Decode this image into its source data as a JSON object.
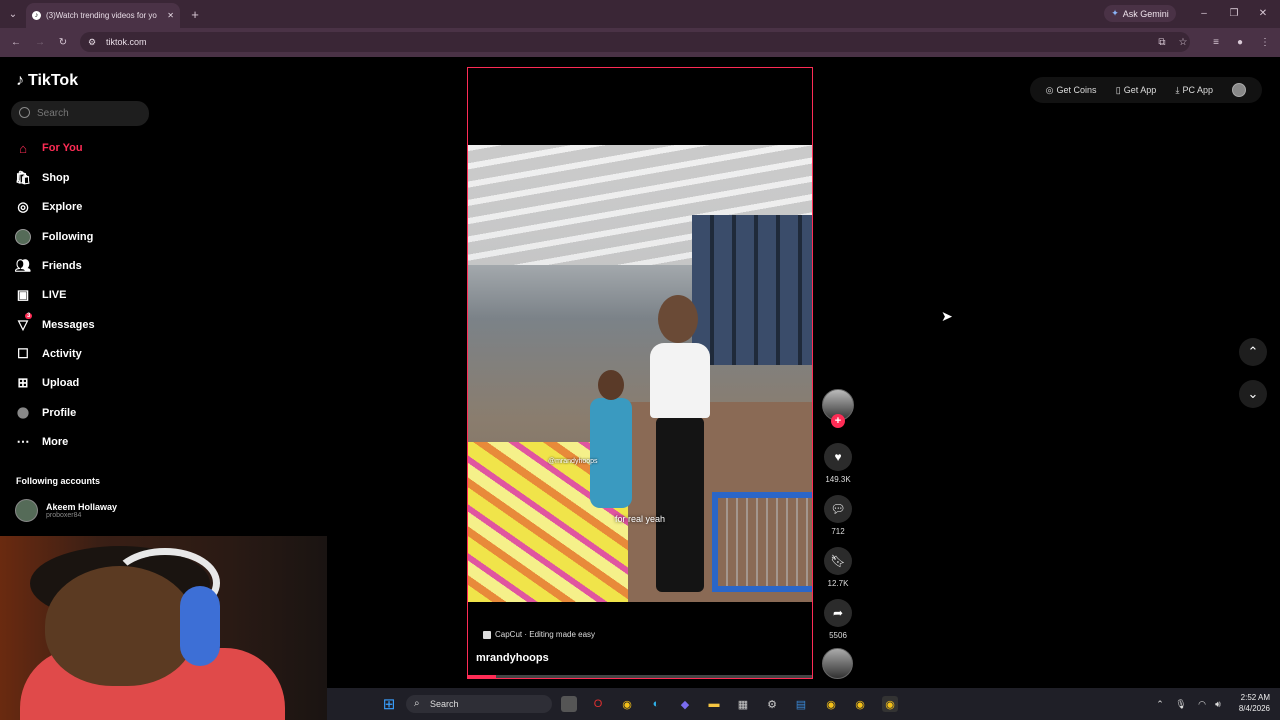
{
  "browser": {
    "tab_title": "(3)Watch trending videos for yo",
    "url": "tiktok.com",
    "ask_gemini": "Ask Gemini"
  },
  "sidebar": {
    "logo": "TikTok",
    "search_placeholder": "Search",
    "items": [
      {
        "label": "For You",
        "icon": "home-icon",
        "active": true
      },
      {
        "label": "Shop",
        "icon": "shop-icon"
      },
      {
        "label": "Explore",
        "icon": "compass-icon"
      },
      {
        "label": "Following",
        "icon": "following-avatar-icon"
      },
      {
        "label": "Friends",
        "icon": "friends-icon"
      },
      {
        "label": "LIVE",
        "icon": "live-icon"
      },
      {
        "label": "Messages",
        "icon": "messages-icon",
        "badge": "3"
      },
      {
        "label": "Activity",
        "icon": "activity-icon"
      },
      {
        "label": "Upload",
        "icon": "upload-icon"
      },
      {
        "label": "Profile",
        "icon": "profile-avatar-icon"
      },
      {
        "label": "More",
        "icon": "more-icon"
      }
    ],
    "following_header": "Following accounts",
    "following": [
      {
        "name": "Akeem Hollaway",
        "handle": "proboxer84"
      }
    ]
  },
  "video": {
    "overlay_text": "for real yeah",
    "watermark": "@mrandyhoops",
    "capcut": "CapCut · Editing made easy",
    "username": "mrandyhoops",
    "progress": 0.08
  },
  "actions": {
    "likes": "149.3K",
    "comments": "712",
    "saves": "12.7K",
    "shares": "5506"
  },
  "topbar": {
    "get_coins": "Get Coins",
    "get_app": "Get App",
    "pc_app": "PC App"
  },
  "taskbar": {
    "search": "Search",
    "time": "2:52 AM",
    "date": "8/4/2026"
  },
  "colors": {
    "accent": "#fe2c55",
    "chrome": "#3a2636"
  }
}
